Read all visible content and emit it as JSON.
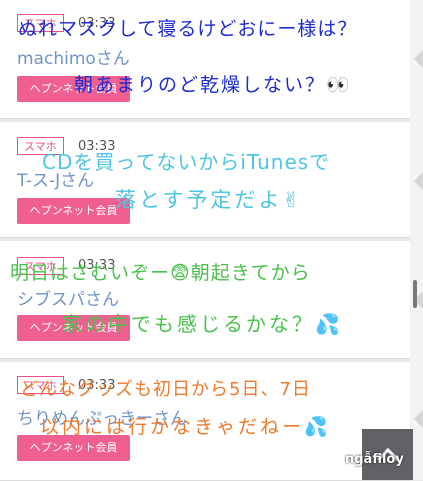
{
  "posts": [
    {
      "badge": "スマホ",
      "time": "03:33",
      "username": "machimoさん",
      "button": "ヘプンネット会員"
    },
    {
      "badge": "スマホ",
      "time": "03:33",
      "username": "T-ス-Jさん",
      "button": "ヘプンネット会員"
    },
    {
      "badge": "スマホ",
      "time": "03:33",
      "username": "シブスパさん",
      "button": "ヘプンネット会員"
    },
    {
      "badge": "スマホ",
      "time": "03:33",
      "username": "ちりめんぷっきーさん",
      "button": "ヘプンネット会員"
    }
  ],
  "overlay": {
    "line1": "ぬれマスクして寝るけどおにー様は？",
    "line2": "朝あまりのど乾燥しない？👀",
    "line3": "CDを買ってないからiTunesで",
    "line4": "落とす予定だよ✌",
    "line5": "明日はさむいぞー😨朝起きてから",
    "line6": "家の中でも感じるかな？💦",
    "line7": "どんなグッズも初日から5日、7日",
    "line8": "以内には行かなきゃだねー💦"
  },
  "watermark": "ngẫfiloy",
  "colors": {
    "accent": "#ef5f90",
    "username": "#6f94c8"
  },
  "icons": {
    "scroll_top": "chevron-up-icon"
  }
}
